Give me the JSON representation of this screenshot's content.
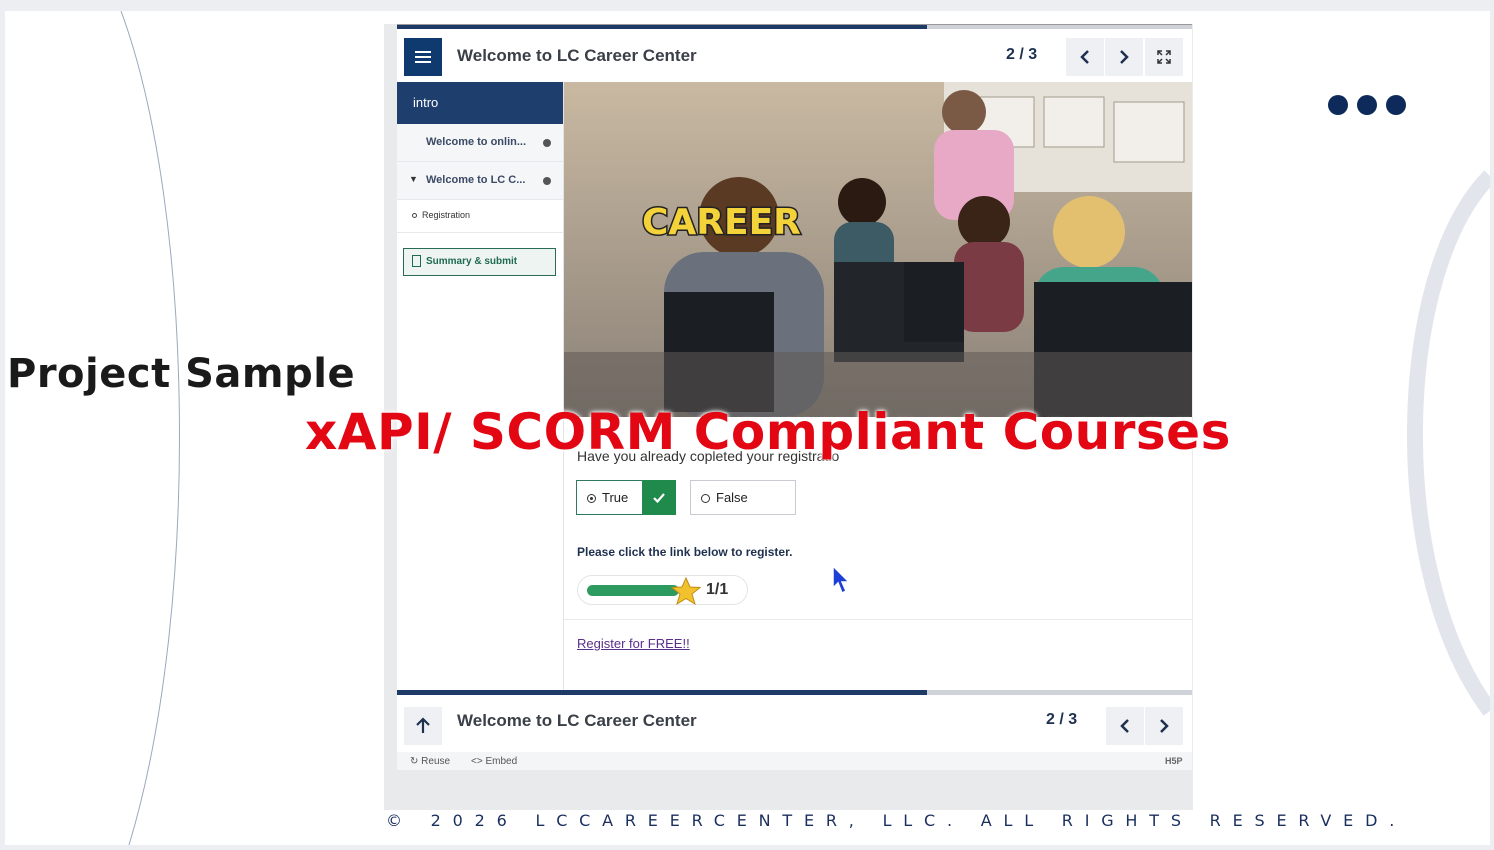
{
  "slide": {
    "project_label": "Project Sample",
    "overlay_title": "xAPI/ SCORM Compliant Courses",
    "copyright": "© 2026 LCCAREERCENTER, LLC. ALL RIGHTS RESERVED."
  },
  "player": {
    "title": "Welcome to LC Career Center",
    "counter": "2 / 3",
    "progress": 0.667,
    "sidebar": {
      "header": "intro",
      "items": [
        {
          "label": "Welcome to onlin..."
        },
        {
          "label": "Welcome to LC C..."
        }
      ],
      "sub_items": [
        {
          "label": "Registration"
        }
      ],
      "summary_label": "Summary & submit"
    },
    "hero": {
      "overlay_text": "CAREER"
    },
    "question": "Have you already copleted your registratio",
    "answers": [
      {
        "label": "True",
        "selected": true,
        "correct": true
      },
      {
        "label": "False",
        "selected": false
      }
    ],
    "instruction": "Please click the link below to register.",
    "score": {
      "text": "1/1",
      "fraction": 1.0
    },
    "register_link": "Register for FREE!!",
    "footer": {
      "reuse": "Reuse",
      "embed": "<> Embed",
      "h5p": "H5P"
    }
  },
  "colors": {
    "navy": "#0f3a70",
    "title_red": "#e30613",
    "success_green": "#1f8a4c",
    "link_purple": "#5a2f8c"
  }
}
